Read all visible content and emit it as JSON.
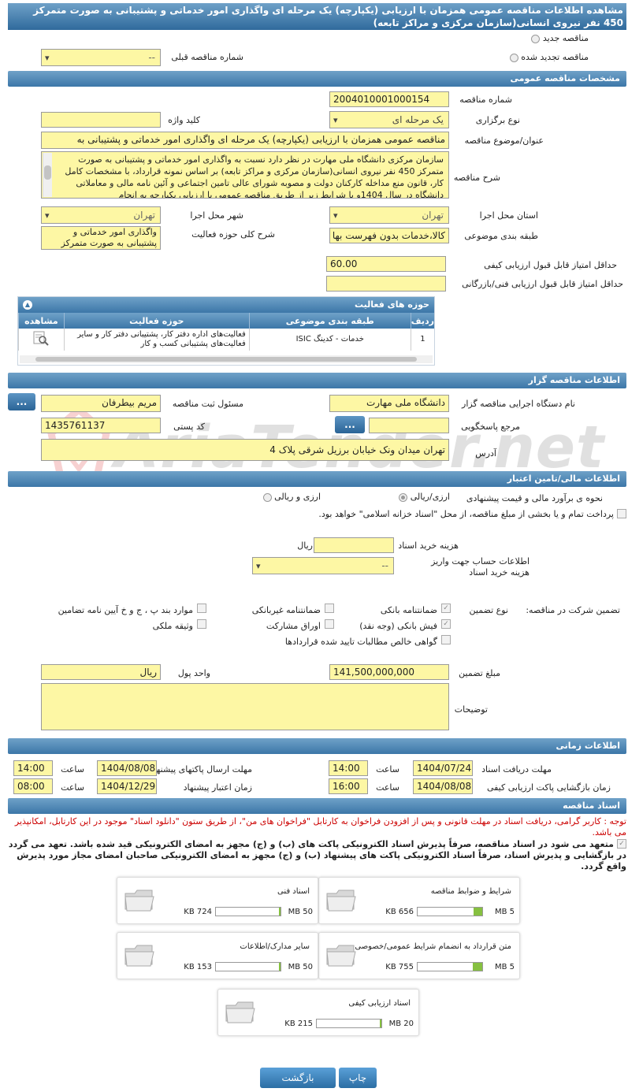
{
  "page": {
    "title": "مشاهده اطلاعات مناقصه عمومی همزمان با ارزیابی (یکپارچه) یک مرحله ای واگذاری امور خدماتی و پشتیبانی به صورت متمرکز 450 نفر نیروی انسانی(سازمان مرکزی و مراکز تابعه)"
  },
  "top": {
    "new_tender": "مناقصه جدید",
    "renewed_tender": "مناقصه تجدید شده",
    "prev_tender_label": "شماره مناقصه قبلی",
    "prev_tender_value": "--"
  },
  "general": {
    "header": "مشخصات مناقصه عمومی",
    "number_label": "شماره مناقصه",
    "number_value": "2004010001000154",
    "type_label": "نوع برگزاری",
    "type_value": "یک مرحله ای",
    "keyword_label": "کلید واژه",
    "subject_label": "عنوان/موضوع مناقصه",
    "subject_value": "مناقصه عمومی همزمان با ارزیابی (یکپارچه) یک مرحله ای  واگذاری امور خدماتی و پشتیبانی به",
    "desc_label": "شرح مناقصه",
    "desc_value": "سازمان مرکزی دانشگاه ملی مهارت در نظر دارد نسبت به واگذاری امور خدماتی و پشتیبانی به صورت متمرکز 450 نفر نیروی انسانی(سازمان مرکزی و مراکز تابعه) بر اساس نمونه قرارداد، با مشخصات کامل کار، قانون منع مداخله کارکنان دولت و مصوبه شورای عالی تامین اجتماعی و آئین نامه مالی و معاملاتی دانشگاه در سال 1404و با شرایط زیر از طریق مناقصه عمومی با ارزیابی یکپارچه به انجام",
    "province_label": "استان محل اجرا",
    "province_value": "تهران",
    "city_label": "شهر محل اجرا",
    "city_value": "تهران",
    "category_label": "طبقه بندی موضوعی",
    "category_value": "کالا،خدمات بدون فهرست بها",
    "activity_desc_label": "شرح کلی حوزه فعالیت",
    "activity_desc_value": "واگذاری امور خدماتی و پشتیبانی به صورت متمرکز",
    "min_quality_label": "حداقل امتیاز قابل قبول ارزیابی کیفی",
    "min_quality_value": "60.00",
    "min_tech_label": "حداقل امتیاز قابل قبول ارزیابی فنی/بازرگانی",
    "min_tech_value": ""
  },
  "activity": {
    "header": "حوزه های فعالیت",
    "columns": [
      "ردیف",
      "طبقه بندی موضوعی",
      "حوزه فعالیت",
      "مشاهده"
    ],
    "rows": [
      {
        "row": "1",
        "category": "خدمات - کدینگ ISIC",
        "field": "فعالیت‌های  اداره دفتر کار، پشتیبانی دفتر کار و سایر  فعالیت‌های پشتیبانی کسب و کار"
      }
    ]
  },
  "organizer": {
    "header": "اطلاعات مناقصه گزار",
    "org_label": "نام دستگاه اجرایی مناقصه گزار",
    "org_value": "دانشگاه ملی مهارت",
    "resp_label": "مسئول ثبت مناقصه",
    "resp_value": "مریم بیطرفان",
    "ref_label": "مرجع پاسخگویی",
    "ref_value": "",
    "postal_label": "کد پستی",
    "postal_value": "1435761137",
    "address_label": "آدرس",
    "address_value": "تهران میدان ونک خیابان برزیل شرقی پلاک 4",
    "more_btn": "..."
  },
  "finance": {
    "header": "اطلاعات مالی/تامین اعتبار",
    "estimate_label": "نحوه ی برآورد مالی و قیمت پیشنهادی",
    "opt1": "ارزی/ریالی",
    "opt2": "ارزی و ریالی",
    "treasury_text": "پرداخت تمام و یا بخشی از مبلغ مناقصه، از محل \"اسناد خزانه اسلامی\" خواهد بود.",
    "doc_fee_label": "هزینه خرید اسناد",
    "doc_fee_unit": "ریال",
    "account_label": "اطلاعات حساب جهت واریز هزینه خرید اسناد",
    "account_value": "--"
  },
  "guarantee": {
    "label": "تضمین شرکت در مناقصه:",
    "type_label": "نوع تضمین",
    "items": [
      "ضمانتنامه بانکی",
      "ضمانتنامه غیربانکی",
      "موارد بند پ ، ج و خ آیین نامه تضامین",
      "فیش بانکی (وجه نقد)",
      "اوراق مشارکت",
      "وثیقه ملکی",
      "گواهی خالص مطالبات تایید شده قراردادها"
    ],
    "amount_label": "مبلغ تضمین",
    "amount_value": "141,500,000,000",
    "currency_label": "واحد پول",
    "currency_value": "ریال",
    "notes_label": "توضیحات"
  },
  "timing": {
    "header": "اطلاعات زمانی",
    "receive_label": "مهلت دریافت اسناد",
    "receive_date": "1404/07/24",
    "receive_time": "14:00",
    "send_label": "مهلت ارسال پاکتهای پیشنهاد",
    "send_date": "1404/08/08",
    "send_time": "14:00",
    "open_label": "زمان بازگشایی پاکت ارزیابی کیفی",
    "open_date": "1404/08/08",
    "open_time": "16:00",
    "valid_label": "زمان اعتبار پیشنهاد",
    "valid_date": "1404/12/29",
    "valid_time": "08:00",
    "time_word": "ساعت"
  },
  "documents": {
    "header": "اسناد مناقصه",
    "notice": "توجه : کاربر گرامی، دریافت اسناد در مهلت قانونی و پس از افزودن فراخوان به کارتابل \"فراخوان های من\"، از طریق ستون \"دانلود اسناد\" موجود در این کارتابل، امکانپذیر می باشد.",
    "commitment": "متعهد می شود در اسناد مناقصه، صرفاً پذیرش اسناد الکترونیکی پاکت های (ب) و (ج) مجهز به امضای الکترونیکی قید شده باشد. تعهد می گردد در بازگشایی و پذیرش اسناد، صرفاً اسناد الکترونیکی پاکت های پیشنهاد (ب) و (ج) مجهز به امضای الکترونیکی صاحبان امضای مجاز مورد پذیرش واقع گردد.",
    "files": [
      {
        "name": "شرایط و ضوابط مناقصه",
        "size": "656 KB",
        "max": "5 MB",
        "ratio": 0.13
      },
      {
        "name": "اسناد فنی",
        "size": "724 KB",
        "max": "50 MB",
        "ratio": 0.015
      },
      {
        "name": "متن قرارداد به انضمام شرایط عمومی/خصوصی",
        "size": "755 KB",
        "max": "5 MB",
        "ratio": 0.15
      },
      {
        "name": "سایر مدارک/اطلاعات",
        "size": "153 KB",
        "max": "50 MB",
        "ratio": 0.003
      },
      {
        "name": "اسناد ارزیابی کیفی",
        "size": "215 KB",
        "max": "20 MB",
        "ratio": 0.011
      }
    ]
  },
  "footer": {
    "print": "چاپ",
    "back": "بازگشت"
  },
  "watermark": "AriaTender.net"
}
